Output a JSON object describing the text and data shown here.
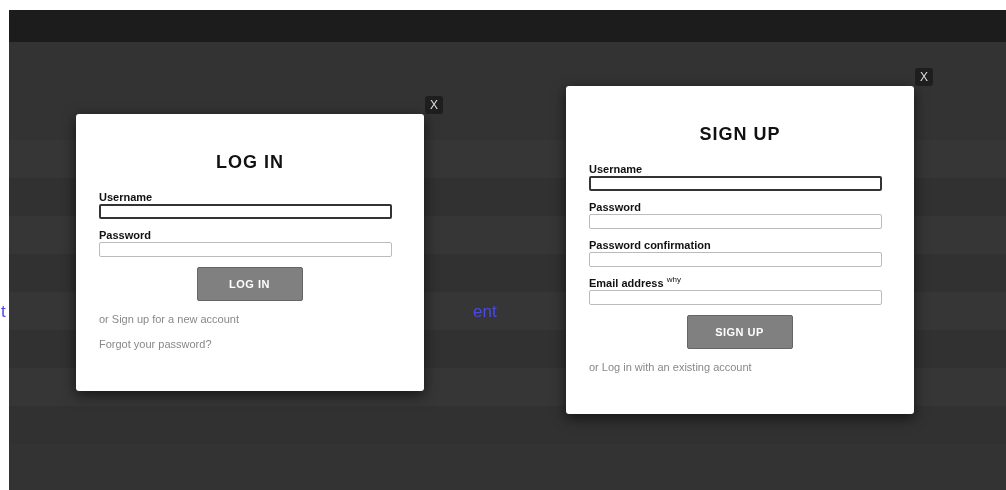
{
  "background": {
    "texts": [
      "t",
      "ent"
    ]
  },
  "login": {
    "close": "X",
    "title": "LOG IN",
    "fields": [
      {
        "label": "Username",
        "focused": true
      },
      {
        "label": "Password",
        "focused": false
      }
    ],
    "button": "LOG IN",
    "links": [
      "or Sign up for a new account",
      "Forgot your password?"
    ]
  },
  "signup": {
    "close": "X",
    "title": "SIGN UP",
    "fields": [
      {
        "label": "Username",
        "focused": true
      },
      {
        "label": "Password",
        "focused": false
      },
      {
        "label": "Password confirmation",
        "focused": false
      },
      {
        "label": "Email address $^{why}$",
        "focused": false
      }
    ],
    "button": "SIGN UP",
    "links": [
      "or Log in with an existing account"
    ]
  }
}
